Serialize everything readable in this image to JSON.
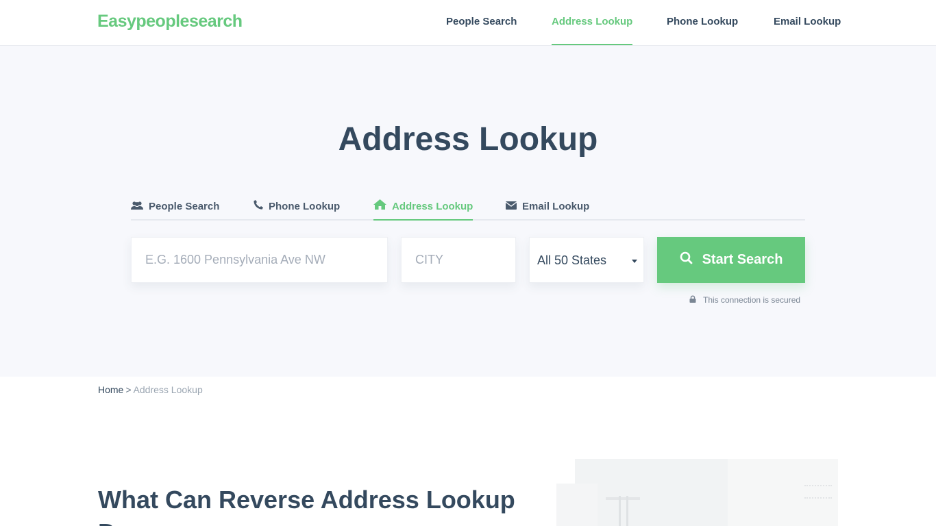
{
  "header": {
    "logo": "Easypeoplesearch",
    "nav": [
      {
        "label": "People Search",
        "active": false
      },
      {
        "label": "Address Lookup",
        "active": true
      },
      {
        "label": "Phone Lookup",
        "active": false
      },
      {
        "label": "Email Lookup",
        "active": false
      }
    ]
  },
  "hero": {
    "title": "Address Lookup",
    "tabs": [
      {
        "label": "People Search",
        "icon": "users-icon",
        "active": false
      },
      {
        "label": "Phone Lookup",
        "icon": "phone-icon",
        "active": false
      },
      {
        "label": "Address Lookup",
        "icon": "home-icon",
        "active": true
      },
      {
        "label": "Email Lookup",
        "icon": "envelope-icon",
        "active": false
      }
    ],
    "form": {
      "address_placeholder": "E.G. 1600 Pennsylvania Ave NW",
      "city_placeholder": "CITY",
      "state_value": "All 50 States",
      "search_label": "Start Search",
      "search_icon": "search-icon",
      "secure_text": "This connection is secured",
      "secure_icon": "lock-icon"
    }
  },
  "breadcrumb": {
    "home": "Home",
    "separator": ">",
    "current": "Address Lookup"
  },
  "content": {
    "heading": "What Can Reverse Address Lookup Do"
  },
  "colors": {
    "accent": "#66c97e",
    "text": "#34495e",
    "hero_bg": "#f7f8fc"
  }
}
